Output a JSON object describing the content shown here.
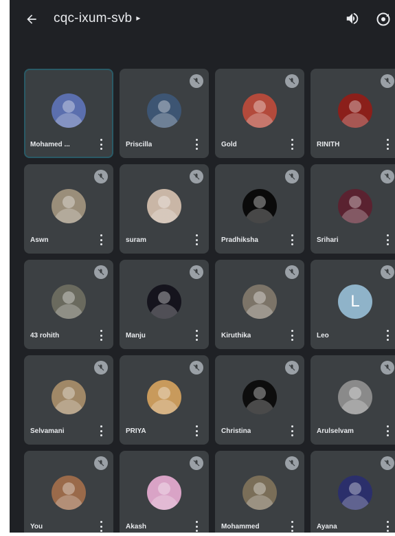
{
  "header": {
    "meeting_code": "cqc-ixum-svb",
    "caret": "▸"
  },
  "participants": [
    {
      "name": "Mohamed ...",
      "muted": false,
      "avatar": "photo",
      "color": "#5b6fae",
      "active": true
    },
    {
      "name": "Priscilla",
      "muted": true,
      "avatar": "photo",
      "color": "#3d5573"
    },
    {
      "name": "Gold",
      "muted": true,
      "avatar": "photo",
      "color": "#b34a3b"
    },
    {
      "name": "RINITH",
      "muted": true,
      "avatar": "photo",
      "color": "#8b1f1a"
    },
    {
      "name": "Aswn",
      "muted": true,
      "avatar": "photo",
      "color": "#9a8e7a"
    },
    {
      "name": "suram",
      "muted": true,
      "avatar": "photo",
      "color": "#c9b6a6"
    },
    {
      "name": "Pradhiksha",
      "muted": true,
      "avatar": "photo",
      "color": "#0a0a0a"
    },
    {
      "name": "Srihari",
      "muted": true,
      "avatar": "photo",
      "color": "#5a2230"
    },
    {
      "name": "43 rohith",
      "muted": true,
      "avatar": "photo",
      "color": "#6a6a5e"
    },
    {
      "name": "Manju",
      "muted": true,
      "avatar": "photo",
      "color": "#15141d"
    },
    {
      "name": "Kiruthika",
      "muted": true,
      "avatar": "photo",
      "color": "#7c7468"
    },
    {
      "name": "Leo",
      "muted": true,
      "avatar": "letter",
      "letter": "L",
      "color": "#8fb3c9"
    },
    {
      "name": "Selvamani",
      "muted": true,
      "avatar": "photo",
      "color": "#a08867"
    },
    {
      "name": "PRIYA",
      "muted": true,
      "avatar": "photo",
      "color": "#c89a5c"
    },
    {
      "name": "Christina",
      "muted": true,
      "avatar": "photo",
      "color": "#0d0d0d"
    },
    {
      "name": "Arulselvam",
      "muted": true,
      "avatar": "photo",
      "color": "#8a8a8a"
    },
    {
      "name": "You",
      "muted": true,
      "avatar": "photo",
      "color": "#9a6a4a"
    },
    {
      "name": "Akash",
      "muted": true,
      "avatar": "photo",
      "color": "#d9a3c6"
    },
    {
      "name": "Mohammed",
      "muted": true,
      "avatar": "photo",
      "color": "#7a6e58"
    },
    {
      "name": "Ayana",
      "muted": true,
      "avatar": "photo",
      "color": "#2b2f6b"
    }
  ],
  "colors": {
    "background": "#1f2125",
    "tile": "#3c4043",
    "active_border": "#2a5a66",
    "text": "#e8eaed",
    "mic_badge": "#9aa0a6"
  }
}
